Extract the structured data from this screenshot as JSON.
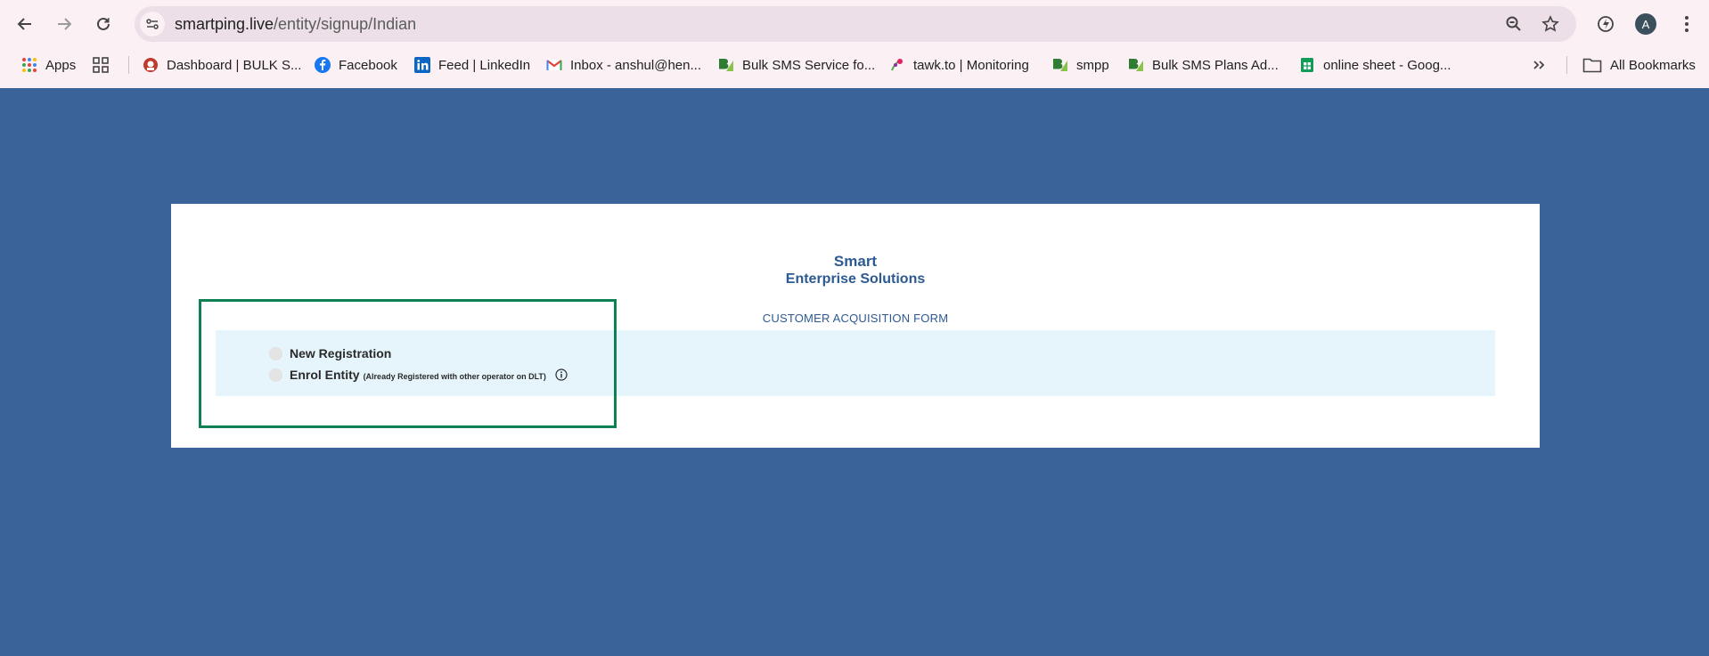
{
  "browser": {
    "url_host": "smartping.live",
    "url_path": "/entity/signup/Indian",
    "avatar_letter": "A",
    "bookmarks": [
      {
        "label": "Apps",
        "icon": "apps-grid-icon"
      },
      {
        "label": "Dashboard | BULK S...",
        "icon": "dashboard-favicon"
      },
      {
        "label": "Facebook",
        "icon": "facebook-icon"
      },
      {
        "label": "Feed | LinkedIn",
        "icon": "linkedin-icon"
      },
      {
        "label": "Inbox - anshul@hen...",
        "icon": "gmail-icon"
      },
      {
        "label": "Bulk SMS Service fo...",
        "icon": "bulksms-favicon"
      },
      {
        "label": "tawk.to | Monitoring",
        "icon": "tawkto-favicon"
      },
      {
        "label": "smpp",
        "icon": "bulksms-favicon"
      },
      {
        "label": "Bulk SMS Plans Ad...",
        "icon": "bulksms-favicon"
      },
      {
        "label": "online sheet - Goog...",
        "icon": "sheets-icon"
      }
    ],
    "all_bookmarks_label": "All Bookmarks"
  },
  "page": {
    "brand_line1": "Smart",
    "brand_line2": "Enterprise Solutions",
    "form_title": "CUSTOMER ACQUISITION FORM",
    "options": [
      {
        "label": "New Registration",
        "note": "",
        "selected": false
      },
      {
        "label": "Enrol Entity",
        "note": "(Already Registered with other operator on DLT)",
        "selected": false
      }
    ]
  },
  "colors": {
    "page_background": "#3a6499",
    "brand_text": "#2d5a92",
    "panel_background": "#e6f5fc",
    "highlight_border": "#0f8054"
  }
}
